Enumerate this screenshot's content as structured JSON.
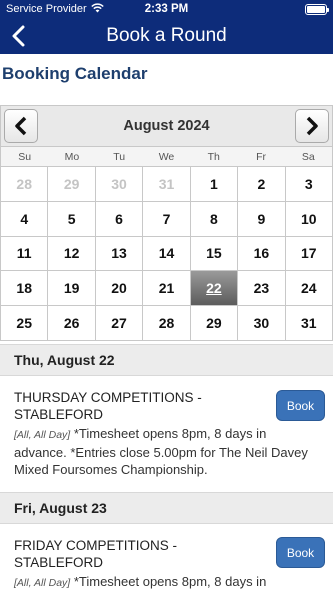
{
  "status_bar": {
    "carrier": "Service Provider",
    "time": "2:33 PM"
  },
  "nav": {
    "title": "Book a Round"
  },
  "section_title": "Booking Calendar",
  "calendar": {
    "month_label": "August 2024",
    "weekdays": [
      "Su",
      "Mo",
      "Tu",
      "We",
      "Th",
      "Fr",
      "Sa"
    ],
    "weeks": [
      [
        {
          "d": "28",
          "muted": true
        },
        {
          "d": "29",
          "muted": true
        },
        {
          "d": "30",
          "muted": true
        },
        {
          "d": "31",
          "muted": true
        },
        {
          "d": "1"
        },
        {
          "d": "2"
        },
        {
          "d": "3"
        }
      ],
      [
        {
          "d": "4"
        },
        {
          "d": "5"
        },
        {
          "d": "6"
        },
        {
          "d": "7"
        },
        {
          "d": "8"
        },
        {
          "d": "9"
        },
        {
          "d": "10"
        }
      ],
      [
        {
          "d": "11"
        },
        {
          "d": "12"
        },
        {
          "d": "13"
        },
        {
          "d": "14"
        },
        {
          "d": "15"
        },
        {
          "d": "16"
        },
        {
          "d": "17"
        }
      ],
      [
        {
          "d": "18"
        },
        {
          "d": "19"
        },
        {
          "d": "20"
        },
        {
          "d": "21"
        },
        {
          "d": "22",
          "selected": true
        },
        {
          "d": "23"
        },
        {
          "d": "24"
        }
      ],
      [
        {
          "d": "25"
        },
        {
          "d": "26"
        },
        {
          "d": "27"
        },
        {
          "d": "28"
        },
        {
          "d": "29"
        },
        {
          "d": "30"
        },
        {
          "d": "31"
        }
      ]
    ]
  },
  "days": [
    {
      "date_label": "Thu, August 22",
      "event": {
        "title": "THURSDAY COMPETITIONS - STABLEFORD",
        "tag": "[All, All Day]",
        "description": "*Timesheet opens 8pm, 8 days in advance. *Entries close 5.00pm for The Neil Davey Mixed Foursomes Championship.",
        "button": "Book"
      }
    },
    {
      "date_label": "Fri, August 23",
      "event": {
        "title": "FRIDAY COMPETITIONS - STABLEFORD",
        "tag": "[All, All Day]",
        "description": "*Timesheet opens 8pm, 8 days in",
        "button": "Book"
      }
    }
  ],
  "colors": {
    "brand": "#0d2c7a",
    "accent": "#3a72b8",
    "heading": "#1e3f6e"
  }
}
